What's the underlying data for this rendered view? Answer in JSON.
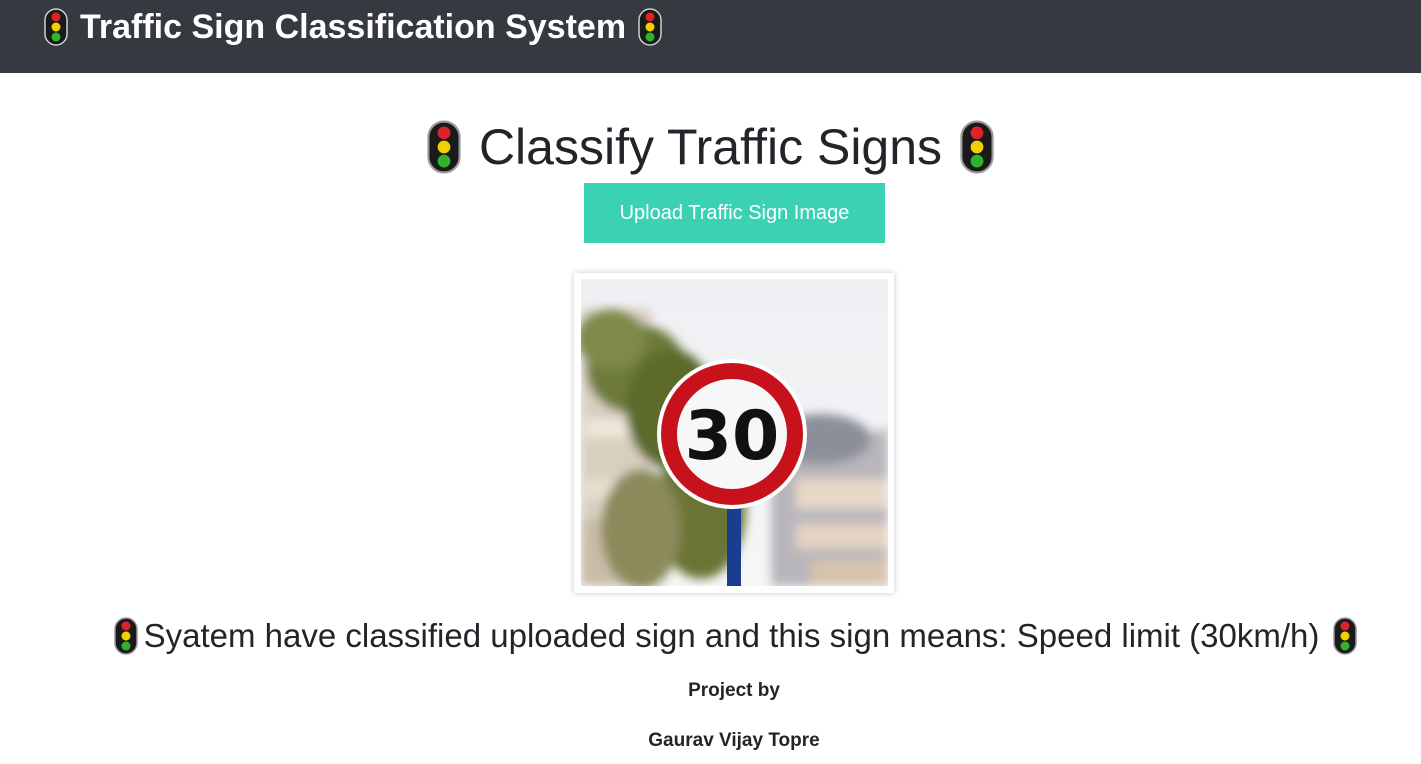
{
  "navbar": {
    "brand_text": "Traffic Sign Classification System",
    "icon": "traffic-light-icon",
    "background": "#343a40"
  },
  "main": {
    "title": "Classify Traffic Signs",
    "upload_button_label": "Upload Traffic Sign Image",
    "accent_color": "#3ad2b3",
    "uploaded_image": {
      "description_icon": "speed-limit-sign-image",
      "sign_text": "30"
    },
    "result_text": "Syatem have classified uploaded sign and this sign means: Speed limit (30km/h)"
  },
  "footer": {
    "credit_label": "Project by",
    "author": "Gaurav Vijay Topre"
  }
}
